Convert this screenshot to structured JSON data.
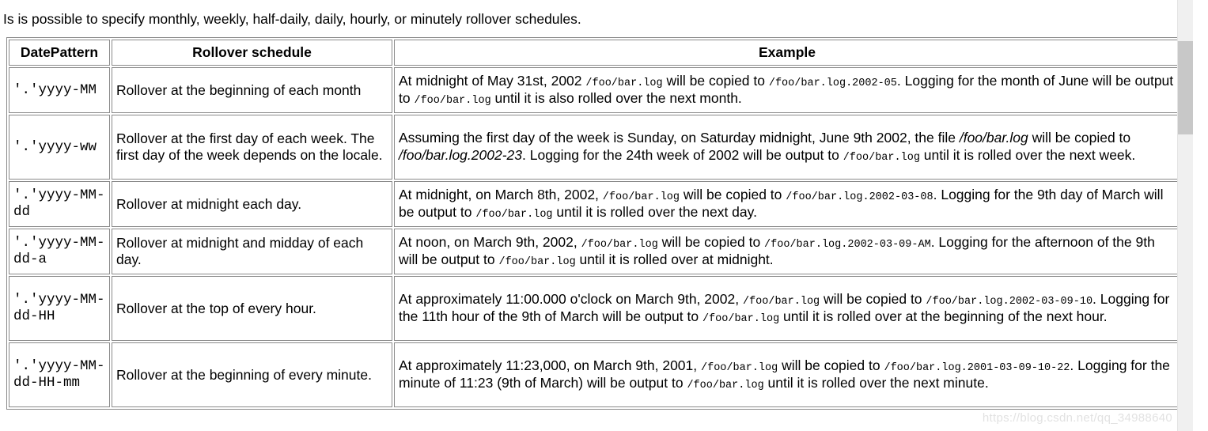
{
  "intro": "Is is possible to specify monthly, weekly, half-daily, daily, hourly, or minutely rollover schedules.",
  "table": {
    "headers": {
      "date_pattern": "DatePattern",
      "rollover_schedule": "Rollover schedule",
      "example": "Example"
    },
    "rows": [
      {
        "pattern": "'.'yyyy-MM",
        "schedule": "Rollover at the beginning of each month",
        "example_parts": [
          {
            "text": "At midnight of May 31st, 2002 ",
            "style": "normal"
          },
          {
            "text": "/foo/bar.log",
            "style": "code"
          },
          {
            "text": " will be copied to ",
            "style": "normal"
          },
          {
            "text": "/foo/bar.log.2002-05",
            "style": "code"
          },
          {
            "text": ". Logging for the month of June will be output to ",
            "style": "normal"
          },
          {
            "text": "/foo/bar.log",
            "style": "code"
          },
          {
            "text": " until it is also rolled over the next month.",
            "style": "normal"
          }
        ]
      },
      {
        "pattern": "'.'yyyy-ww",
        "schedule": "Rollover at the first day of each week. The first day of the week depends on the locale.",
        "example_parts": [
          {
            "text": "Assuming the first day of the week is Sunday, on Saturday midnight, June 9th 2002, the file ",
            "style": "normal"
          },
          {
            "text": "/foo/bar.log",
            "style": "italic"
          },
          {
            "text": " will be copied to ",
            "style": "normal"
          },
          {
            "text": "/foo/bar.log.2002-23",
            "style": "italic"
          },
          {
            "text": ". Logging for the 24th week of 2002 will be output to ",
            "style": "normal"
          },
          {
            "text": "/foo/bar.log",
            "style": "code"
          },
          {
            "text": " until it is rolled over the next week.",
            "style": "normal"
          }
        ]
      },
      {
        "pattern": "'.'yyyy-MM-dd",
        "schedule": "Rollover at midnight each day.",
        "example_parts": [
          {
            "text": "At midnight, on March 8th, 2002, ",
            "style": "normal"
          },
          {
            "text": "/foo/bar.log",
            "style": "code"
          },
          {
            "text": " will be copied to ",
            "style": "normal"
          },
          {
            "text": "/foo/bar.log.2002-03-08",
            "style": "code"
          },
          {
            "text": ". Logging for the 9th day of March will be output to ",
            "style": "normal"
          },
          {
            "text": "/foo/bar.log",
            "style": "code"
          },
          {
            "text": " until it is rolled over the next day.",
            "style": "normal"
          }
        ]
      },
      {
        "pattern": "'.'yyyy-MM-dd-a",
        "schedule": "Rollover at midnight and midday of each day.",
        "example_parts": [
          {
            "text": "At noon, on March 9th, 2002, ",
            "style": "normal"
          },
          {
            "text": "/foo/bar.log",
            "style": "code"
          },
          {
            "text": " will be copied to ",
            "style": "normal"
          },
          {
            "text": "/foo/bar.log.2002-03-09-AM",
            "style": "code"
          },
          {
            "text": ". Logging for the afternoon of the 9th will be output to ",
            "style": "normal"
          },
          {
            "text": "/foo/bar.log",
            "style": "code"
          },
          {
            "text": " until it is rolled over at midnight.",
            "style": "normal"
          }
        ]
      },
      {
        "pattern": "'.'yyyy-MM-dd-HH",
        "schedule": "Rollover at the top of every hour.",
        "example_parts": [
          {
            "text": "At approximately 11:00.000 o'clock on March 9th, 2002, ",
            "style": "normal"
          },
          {
            "text": "/foo/bar.log",
            "style": "code"
          },
          {
            "text": " will be copied to ",
            "style": "normal"
          },
          {
            "text": "/foo/bar.log.2002-03-09-10",
            "style": "code"
          },
          {
            "text": ". Logging for the 11th hour of the 9th of March will be output to ",
            "style": "normal"
          },
          {
            "text": "/foo/bar.log",
            "style": "code"
          },
          {
            "text": " until it is rolled over at the beginning of the next hour.",
            "style": "normal"
          }
        ]
      },
      {
        "pattern": "'.'yyyy-MM-dd-HH-mm",
        "schedule": "Rollover at the beginning of every minute.",
        "example_parts": [
          {
            "text": "At approximately 11:23,000, on March 9th, 2001, ",
            "style": "normal"
          },
          {
            "text": "/foo/bar.log",
            "style": "code"
          },
          {
            "text": " will be copied to ",
            "style": "normal"
          },
          {
            "text": "/foo/bar.log.2001-03-09-10-22",
            "style": "code"
          },
          {
            "text": ". Logging for the minute of 11:23 (9th of March) will be output to ",
            "style": "normal"
          },
          {
            "text": "/foo/bar.log",
            "style": "code"
          },
          {
            "text": " until it is rolled over the next minute.",
            "style": "normal"
          }
        ]
      }
    ]
  },
  "watermark": "https://blog.csdn.net/qq_34988640"
}
